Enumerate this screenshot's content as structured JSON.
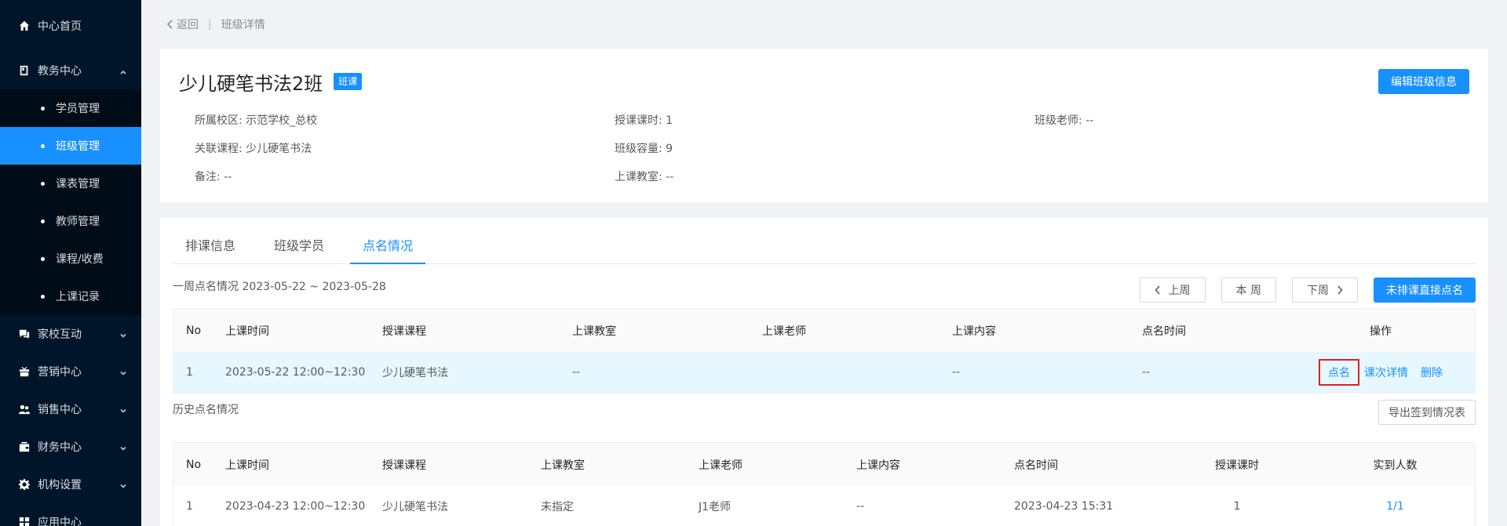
{
  "sidebar": {
    "items": [
      {
        "label": "中心首页",
        "icon": "home-icon"
      },
      {
        "label": "教务中心",
        "icon": "book-icon",
        "expanded": true,
        "children": [
          {
            "label": "学员管理"
          },
          {
            "label": "班级管理",
            "active": true
          },
          {
            "label": "课表管理"
          },
          {
            "label": "教师管理"
          },
          {
            "label": "课程/收费"
          },
          {
            "label": "上课记录"
          }
        ]
      },
      {
        "label": "家校互动",
        "icon": "chat-icon"
      },
      {
        "label": "营销中心",
        "icon": "gift-icon"
      },
      {
        "label": "销售中心",
        "icon": "people-icon"
      },
      {
        "label": "财务中心",
        "icon": "wallet-icon"
      },
      {
        "label": "机构设置",
        "icon": "gear-icon"
      },
      {
        "label": "应用中心",
        "icon": "grid-icon"
      }
    ]
  },
  "breadcrumb": {
    "back": "返回",
    "sep": "|",
    "current": "班级详情"
  },
  "class_info": {
    "title": "少儿硬笔书法2班",
    "tag": "班课",
    "edit_button": "编辑班级信息",
    "fields": [
      "所属校区: 示范学校_总校",
      "授课课时: 1",
      "班级老师: --",
      "关联课程: 少儿硬笔书法",
      "班级容量: 9",
      "",
      "备注: --",
      "上课教室: --",
      ""
    ]
  },
  "tabs": [
    "排课信息",
    "班级学员",
    "点名情况"
  ],
  "active_tab": 2,
  "week": {
    "label": "一周点名情况 2023-05-22 ~ 2023-05-28",
    "prev": "上周",
    "this": "本 周",
    "next": "下周",
    "direct_roll": "未排课直接点名"
  },
  "week_table": {
    "headers": [
      "No",
      "上课时间",
      "授课课程",
      "上课教室",
      "上课老师",
      "上课内容",
      "点名时间",
      "操作"
    ],
    "rows": [
      {
        "no": "1",
        "time": "2023-05-22 12:00~12:30",
        "course": "少儿硬笔书法",
        "room": "--",
        "teacher": "",
        "content": "--",
        "roll_time": "--",
        "ops": [
          "点名",
          "课次详情",
          "删除"
        ]
      }
    ]
  },
  "history": {
    "label": "历史点名情况",
    "export": "导出签到情况表",
    "headers": [
      "No",
      "上课时间",
      "授课课程",
      "上课教室",
      "上课老师",
      "上课内容",
      "点名时间",
      "授课课时",
      "实到人数"
    ],
    "rows": [
      {
        "no": "1",
        "time": "2023-04-23 12:00~12:30",
        "course": "少儿硬笔书法",
        "room": "未指定",
        "teacher": "J1老师",
        "content": "--",
        "roll_time": "2023-04-23 15:31",
        "hours": "1",
        "attended": "1/1"
      }
    ]
  },
  "colors": {
    "primary": "#1890ff",
    "sidebar_bg": "#001529",
    "highlight": "#e02020"
  }
}
